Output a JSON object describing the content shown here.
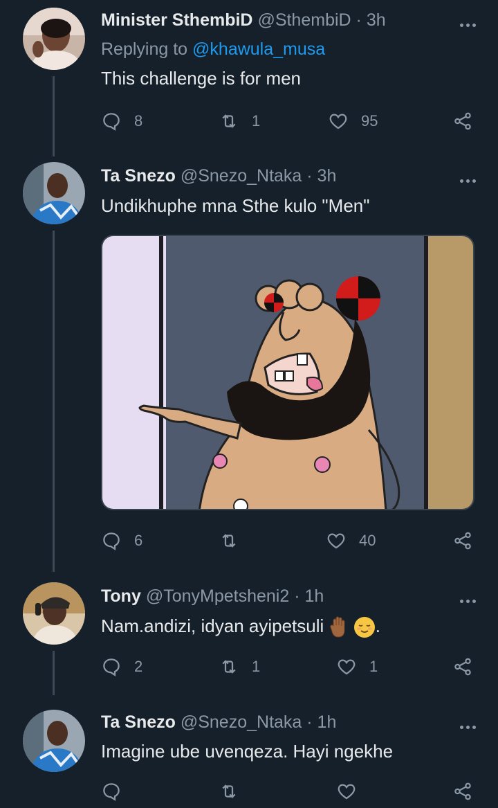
{
  "tweets": [
    {
      "name": "Minister SthembiD",
      "handle": "@SthembiD",
      "time": "3h",
      "replying_prefix": "Replying to ",
      "replying_to": "@khawula_musa",
      "text": "This challenge is for men",
      "replies": "8",
      "retweets": "1",
      "likes": "95"
    },
    {
      "name": "Ta Snezo",
      "handle": "@Snezo_Ntaka",
      "time": "3h",
      "text": "Undikhuphe mna Sthe kulo \"Men\"",
      "replies": "6",
      "retweets": "",
      "likes": "40",
      "has_media": true
    },
    {
      "name": "Tony",
      "handle": "@TonyMpetsheni2",
      "time": "1h",
      "text": "Nam.andizi, idyan ayipetsuli",
      "text_suffix": ".",
      "emojis": [
        "raised-hand-emoji",
        "relieved-face-emoji"
      ],
      "replies": "2",
      "retweets": "1",
      "likes": "1"
    },
    {
      "name": "Ta Snezo",
      "handle": "@Snezo_Ntaka",
      "time": "1h",
      "text": "Imagine ube uvenqeza. Hayi ngekhe",
      "replies": "",
      "retweets": "",
      "likes": ""
    }
  ],
  "sep": " · ",
  "colors": {
    "background": "#15202b",
    "text": "#e7e9ea",
    "muted": "#8b98a5",
    "link": "#1d9bf0",
    "thread_line": "#3d4a56"
  }
}
